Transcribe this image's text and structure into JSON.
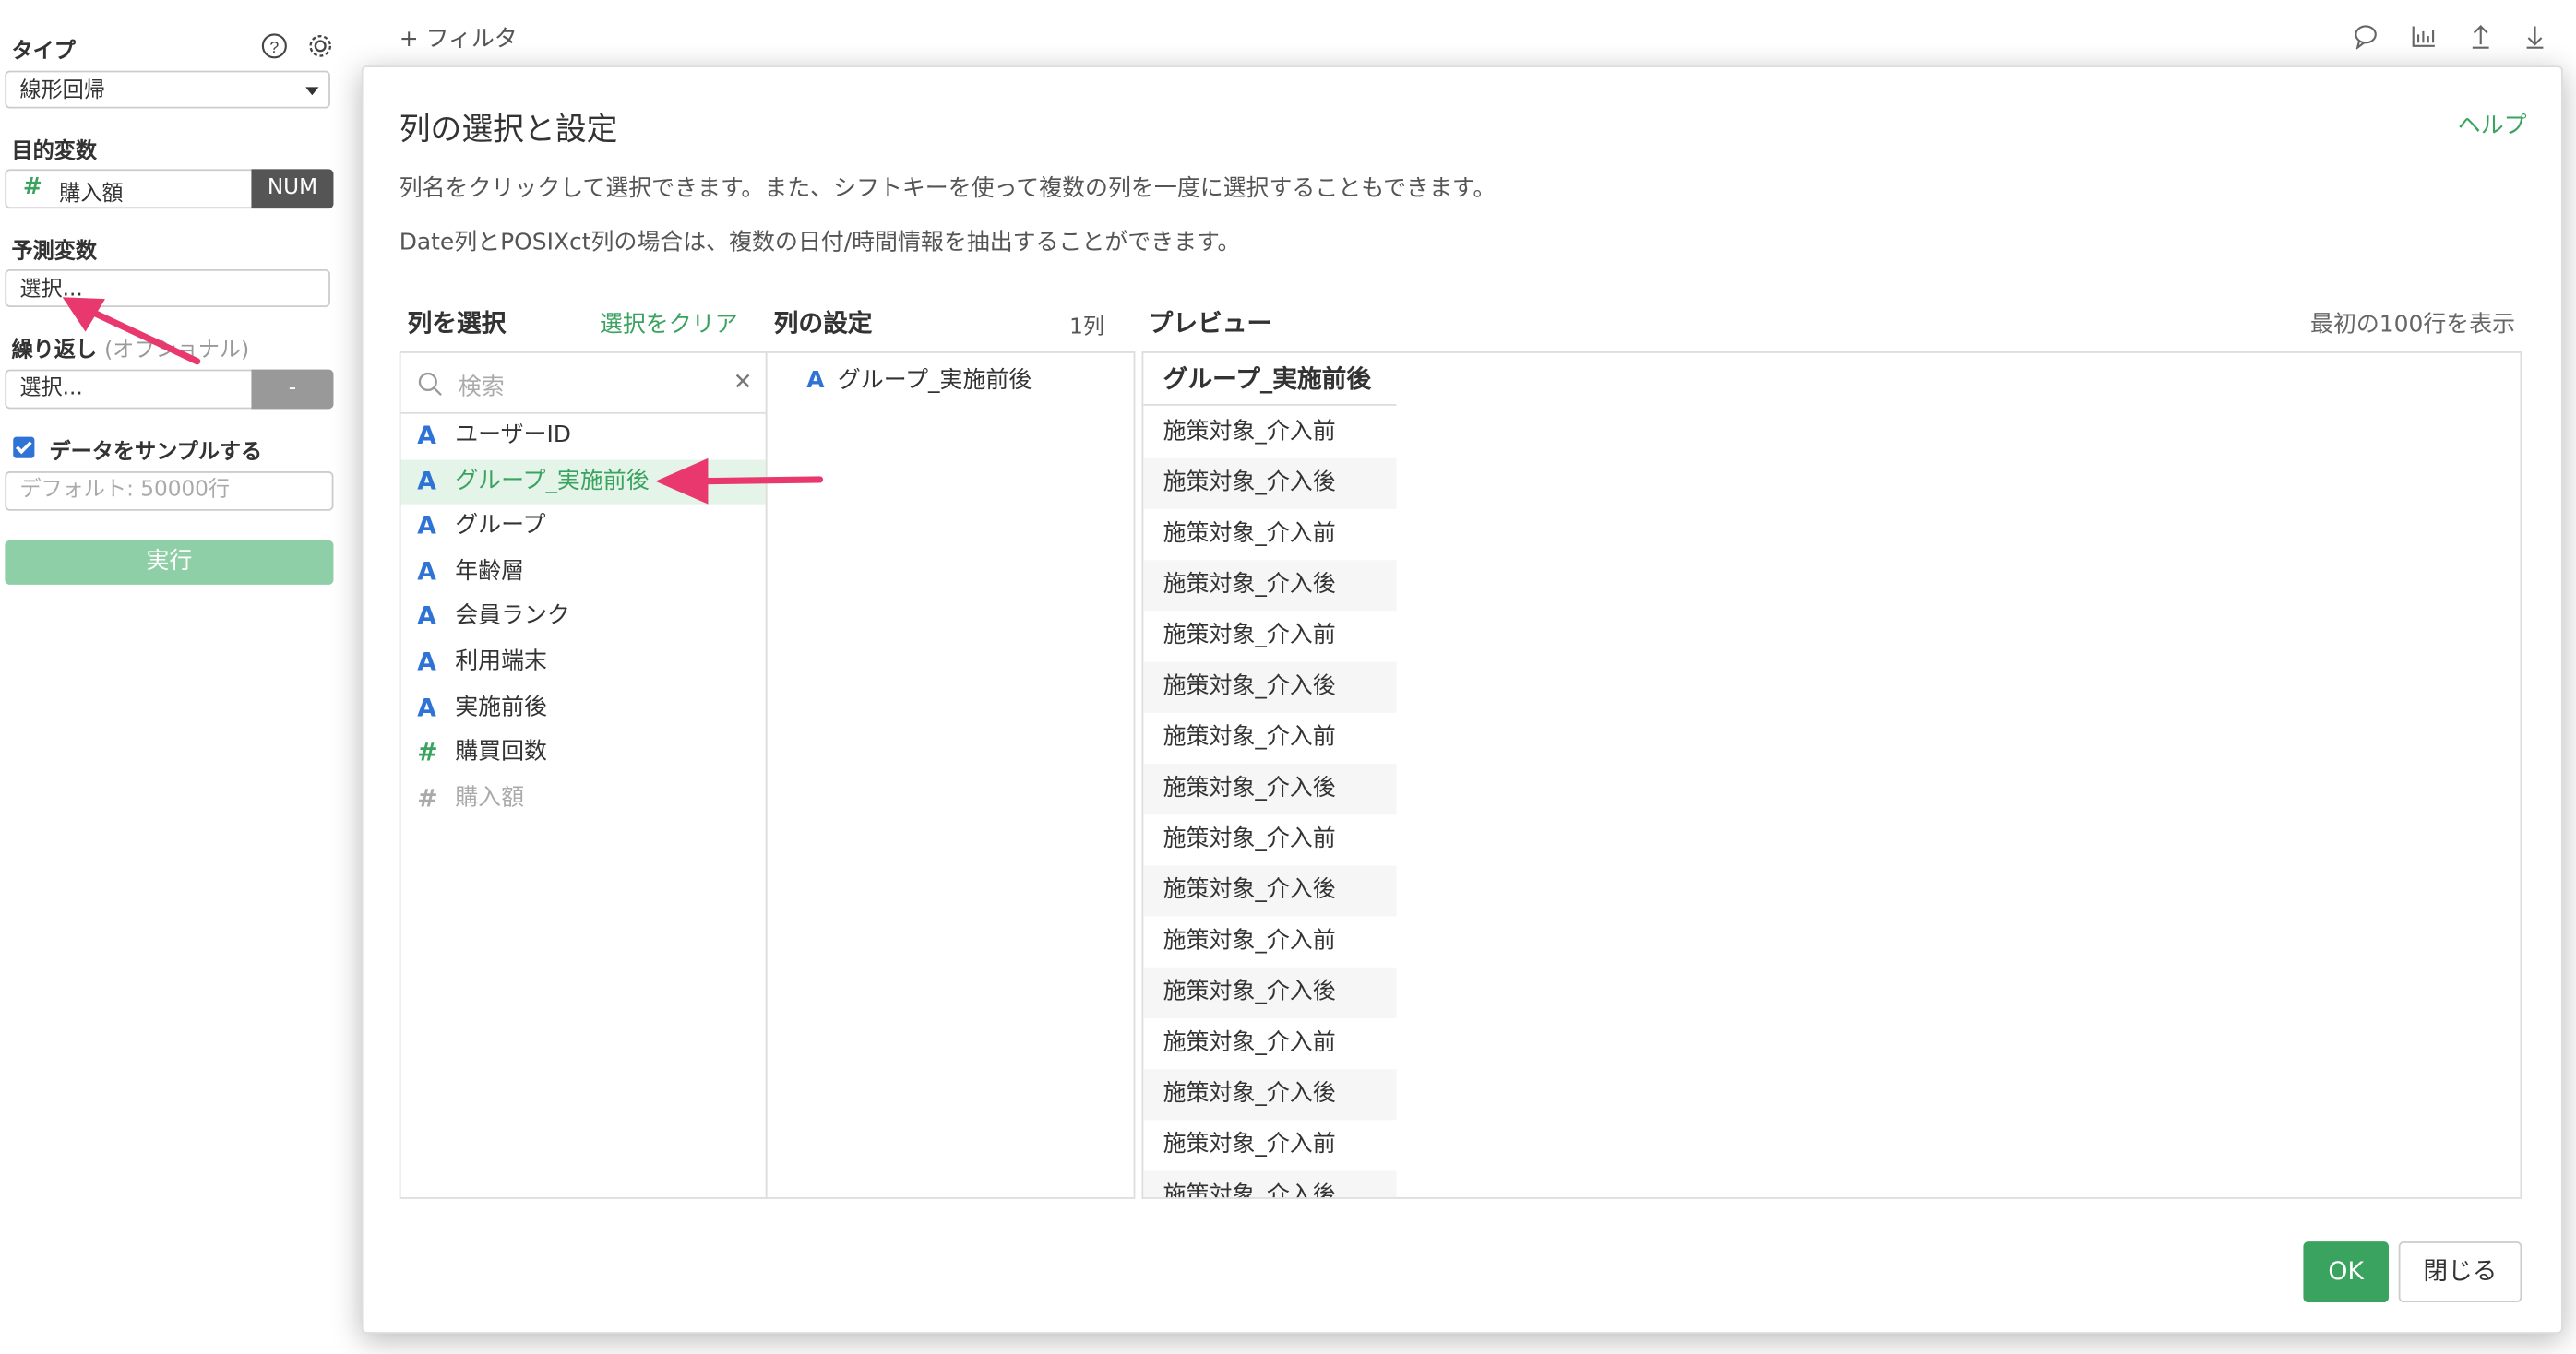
{
  "sidebar": {
    "type_label": "タイプ",
    "type_value": "線形回帰",
    "target_label": "目的変数",
    "target_value": "購入額",
    "target_type": "NUM",
    "predictor_label": "予測変数",
    "predictor_value": "選択...",
    "repeat_label": "繰り返し",
    "repeat_optional": "(オプショナル)",
    "repeat_value": "選択...",
    "repeat_button": "-",
    "sample_label": "データをサンプルする",
    "sample_placeholder": "デフォルト: 50000行",
    "run_label": "実行"
  },
  "topbar": {
    "filter_label": "+ フィルタ",
    "icons": [
      "comment-icon",
      "chart-icon",
      "upload-icon",
      "download-icon"
    ]
  },
  "modal": {
    "title": "列の選択と設定",
    "help": "ヘルプ",
    "desc1": "列名をクリックして選択できます。また、シフトキーを使って複数の列を一度に選択することもできます。",
    "desc2": "Date列とPOSIXct列の場合は、複数の日付/時間情報を抽出することができます。",
    "select_header": "列を選択",
    "clear_link": "選択をクリア",
    "settings_header": "列の設定",
    "col_count": "1列",
    "preview_header": "プレビュー",
    "first_rows": "最初の100行を表示",
    "search_placeholder": "検索",
    "columns": [
      {
        "type": "A",
        "name": "ユーザーID",
        "selected": false,
        "disabled": false
      },
      {
        "type": "A",
        "name": "グループ_実施前後",
        "selected": true,
        "disabled": false
      },
      {
        "type": "A",
        "name": "グループ",
        "selected": false,
        "disabled": false
      },
      {
        "type": "A",
        "name": "年齢層",
        "selected": false,
        "disabled": false
      },
      {
        "type": "A",
        "name": "会員ランク",
        "selected": false,
        "disabled": false
      },
      {
        "type": "A",
        "name": "利用端末",
        "selected": false,
        "disabled": false
      },
      {
        "type": "A",
        "name": "実施前後",
        "selected": false,
        "disabled": false
      },
      {
        "type": "#",
        "name": "購買回数",
        "selected": false,
        "disabled": false
      },
      {
        "type": "#",
        "name": "購入額",
        "selected": false,
        "disabled": true
      }
    ],
    "selected_settings": [
      {
        "type": "A",
        "name": "グループ_実施前後"
      }
    ],
    "preview_column": "グループ_実施前後",
    "preview_rows": [
      "施策対象_介入前",
      "施策対象_介入後",
      "施策対象_介入前",
      "施策対象_介入後",
      "施策対象_介入前",
      "施策対象_介入後",
      "施策対象_介入前",
      "施策対象_介入後",
      "施策対象_介入前",
      "施策対象_介入後",
      "施策対象_介入前",
      "施策対象_介入後",
      "施策対象_介入前",
      "施策対象_介入後",
      "施策対象_介入前",
      "施策対象_介入後"
    ],
    "ok_label": "OK",
    "close_label": "閉じる"
  },
  "colors": {
    "accent_green": "#3aa35f",
    "type_blue": "#2f73d6",
    "arrow_pink": "#e8386d"
  }
}
